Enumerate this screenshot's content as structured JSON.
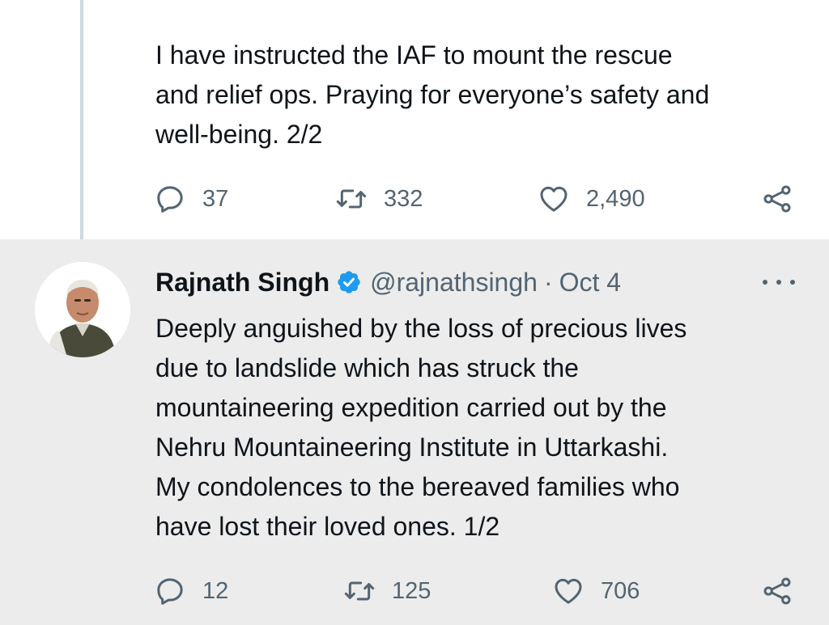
{
  "thread": {
    "top_tweet": {
      "text": "I have instructed the IAF to mount the rescue\nand relief ops. Praying for everyone’s safety and\nwell-being. 2/2",
      "actions": {
        "replies": "37",
        "retweets": "332",
        "likes": "2,490"
      }
    },
    "bottom_tweet": {
      "author_name": "Rajnath Singh",
      "handle": "@rajnathsingh",
      "separator": "·",
      "date": "Oct 4",
      "text": "Deeply anguished by the loss of precious lives\ndue to landslide which has struck the\nmountaineering expedition carried out by the\nNehru Mountaineering Institute in Uttarkashi.\nMy condolences to the bereaved families who\nhave lost their loved ones. 1/2",
      "actions": {
        "replies": "12",
        "retweets": "125",
        "likes": "706"
      }
    }
  },
  "icons": {
    "reply": "reply-icon",
    "retweet": "retweet-icon",
    "like": "heart-icon",
    "share": "share-icon",
    "verified": "verified-badge-icon",
    "more": "more-options-icon"
  },
  "colors": {
    "text": "#0f1419",
    "secondary": "#536471",
    "verified_blue": "#1d9bf0",
    "thread_line": "#cfd9de",
    "highlight_bg": "#ececec"
  }
}
